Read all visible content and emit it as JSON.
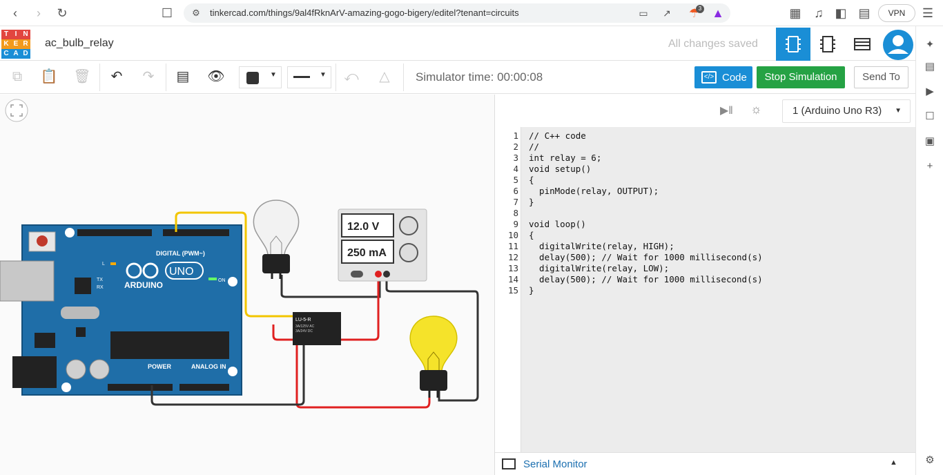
{
  "browser": {
    "url": "tinkercad.com/things/9al4fRknArV-amazing-gogo-bigery/editel?tenant=circuits",
    "vpn_label": "VPN",
    "shield_badge": "3"
  },
  "logo": {
    "letters": [
      "T",
      "I",
      "N",
      "K",
      "E",
      "R",
      "C",
      "A",
      "D"
    ]
  },
  "header": {
    "project_name": "ac_bulb_relay",
    "save_status": "All changes saved"
  },
  "toolbar": {
    "sim_time": "Simulator time: 00:00:08",
    "code_label": "Code",
    "stop_label": "Stop Simulation",
    "send_label": "Send To"
  },
  "circuit": {
    "voltage": "12.0 V",
    "current": "250 mA",
    "relay_name": "LU-5-R",
    "relay_spec1": "3A/125V AC",
    "relay_spec2": "3A/24V DC",
    "board_brand": "ARDUINO",
    "board_model": "UNO",
    "digital_label": "DIGITAL (PWM~)",
    "power_label": "POWER",
    "analog_label": "ANALOG IN",
    "on_label": "ON",
    "tx_label": "TX",
    "rx_label": "RX",
    "l_label": "L"
  },
  "code_panel": {
    "device": "1 (Arduino Uno R3)",
    "serial_monitor": "Serial Monitor"
  },
  "code_lines": [
    "// C++ code",
    "//",
    "int relay = 6;",
    "void setup()",
    "{",
    "  pinMode(relay, OUTPUT);",
    "}",
    "",
    "void loop()",
    "{",
    "  digitalWrite(relay, HIGH);",
    "  delay(500); // Wait for 1000 millisecond(s)",
    "  digitalWrite(relay, LOW);",
    "  delay(500); // Wait for 1000 millisecond(s)",
    "}"
  ],
  "colors": {
    "accent_blue": "#1a8ed6",
    "stop_green": "#25a244",
    "board_blue": "#1f6ea8",
    "wire_red": "#e02020",
    "wire_yellow": "#f2c500",
    "wire_black": "#333333",
    "bulb_lit": "#f5e32a"
  }
}
